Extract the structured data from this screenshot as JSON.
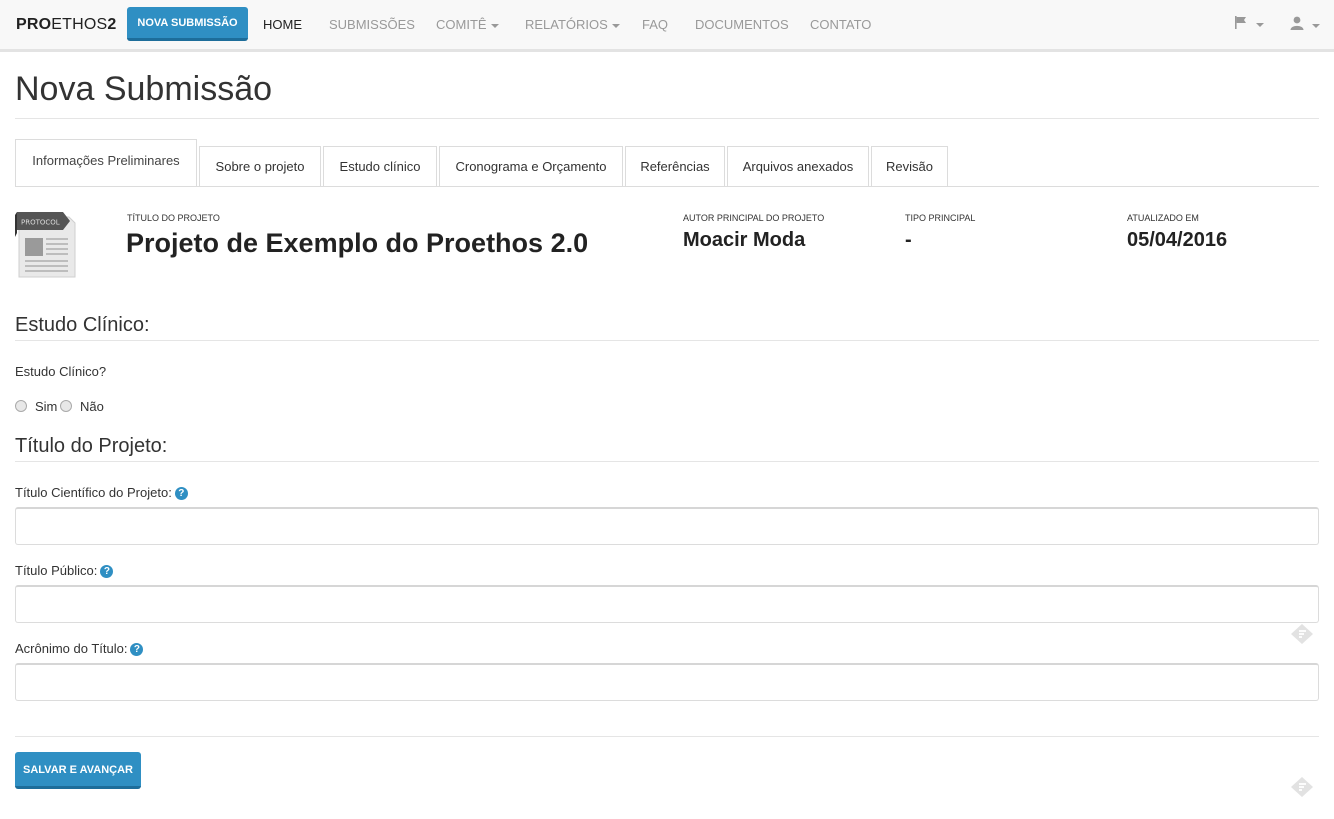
{
  "navbar": {
    "brand_bold": "PRO",
    "brand_light": "ETHOS",
    "brand_num": "2",
    "nova_submissao": "NOVA SUBMISSÃO",
    "items": [
      {
        "label": "HOME",
        "active": true
      },
      {
        "label": "SUBMISSÕES",
        "active": false
      },
      {
        "label": "COMITÊ",
        "active": false,
        "dropdown": true
      },
      {
        "label": "RELATÓRIOS",
        "active": false,
        "dropdown": true
      },
      {
        "label": "FAQ",
        "active": false
      },
      {
        "label": "DOCUMENTOS",
        "active": false
      },
      {
        "label": "CONTATO",
        "active": false
      }
    ],
    "icons": [
      "flag-icon",
      "user-icon"
    ]
  },
  "page_title": "Nova Submissão",
  "tabs": [
    {
      "label": "Informações Preliminares",
      "active": true
    },
    {
      "label": "Sobre o projeto",
      "active": false
    },
    {
      "label": "Estudo clínico",
      "active": false
    },
    {
      "label": "Cronograma e Orçamento",
      "active": false
    },
    {
      "label": "Referências",
      "active": false
    },
    {
      "label": "Arquivos anexados",
      "active": false
    },
    {
      "label": "Revisão",
      "active": false
    }
  ],
  "protocol": {
    "icon_label": "PROTOCOL",
    "title_label": "TÍTULO DO PROJETO",
    "title": "Projeto de Exemplo do Proethos 2.0",
    "author_label": "AUTOR PRINCIPAL DO PROJETO",
    "author": "Moacir Moda",
    "type_label": "TIPO PRINCIPAL",
    "type": "-",
    "updated_label": "ATUALIZADO EM",
    "updated": "05/04/2016"
  },
  "estudo_clinico": {
    "section_title": "Estudo Clínico:",
    "question": "Estudo Clínico?",
    "options": [
      "Sim",
      "Não"
    ]
  },
  "titulo_projeto": {
    "section_title": "Título do Projeto:",
    "fields": [
      {
        "label": "Título Científico do Projeto:",
        "value": ""
      },
      {
        "label": "Título Público:",
        "value": ""
      },
      {
        "label": "Acrônimo do Título:",
        "value": ""
      }
    ]
  },
  "actions": {
    "save": "SALVAR E AVANÇAR"
  },
  "colors": {
    "primary": "#2f8fc3",
    "navbar_bg": "#f8f8f8"
  }
}
